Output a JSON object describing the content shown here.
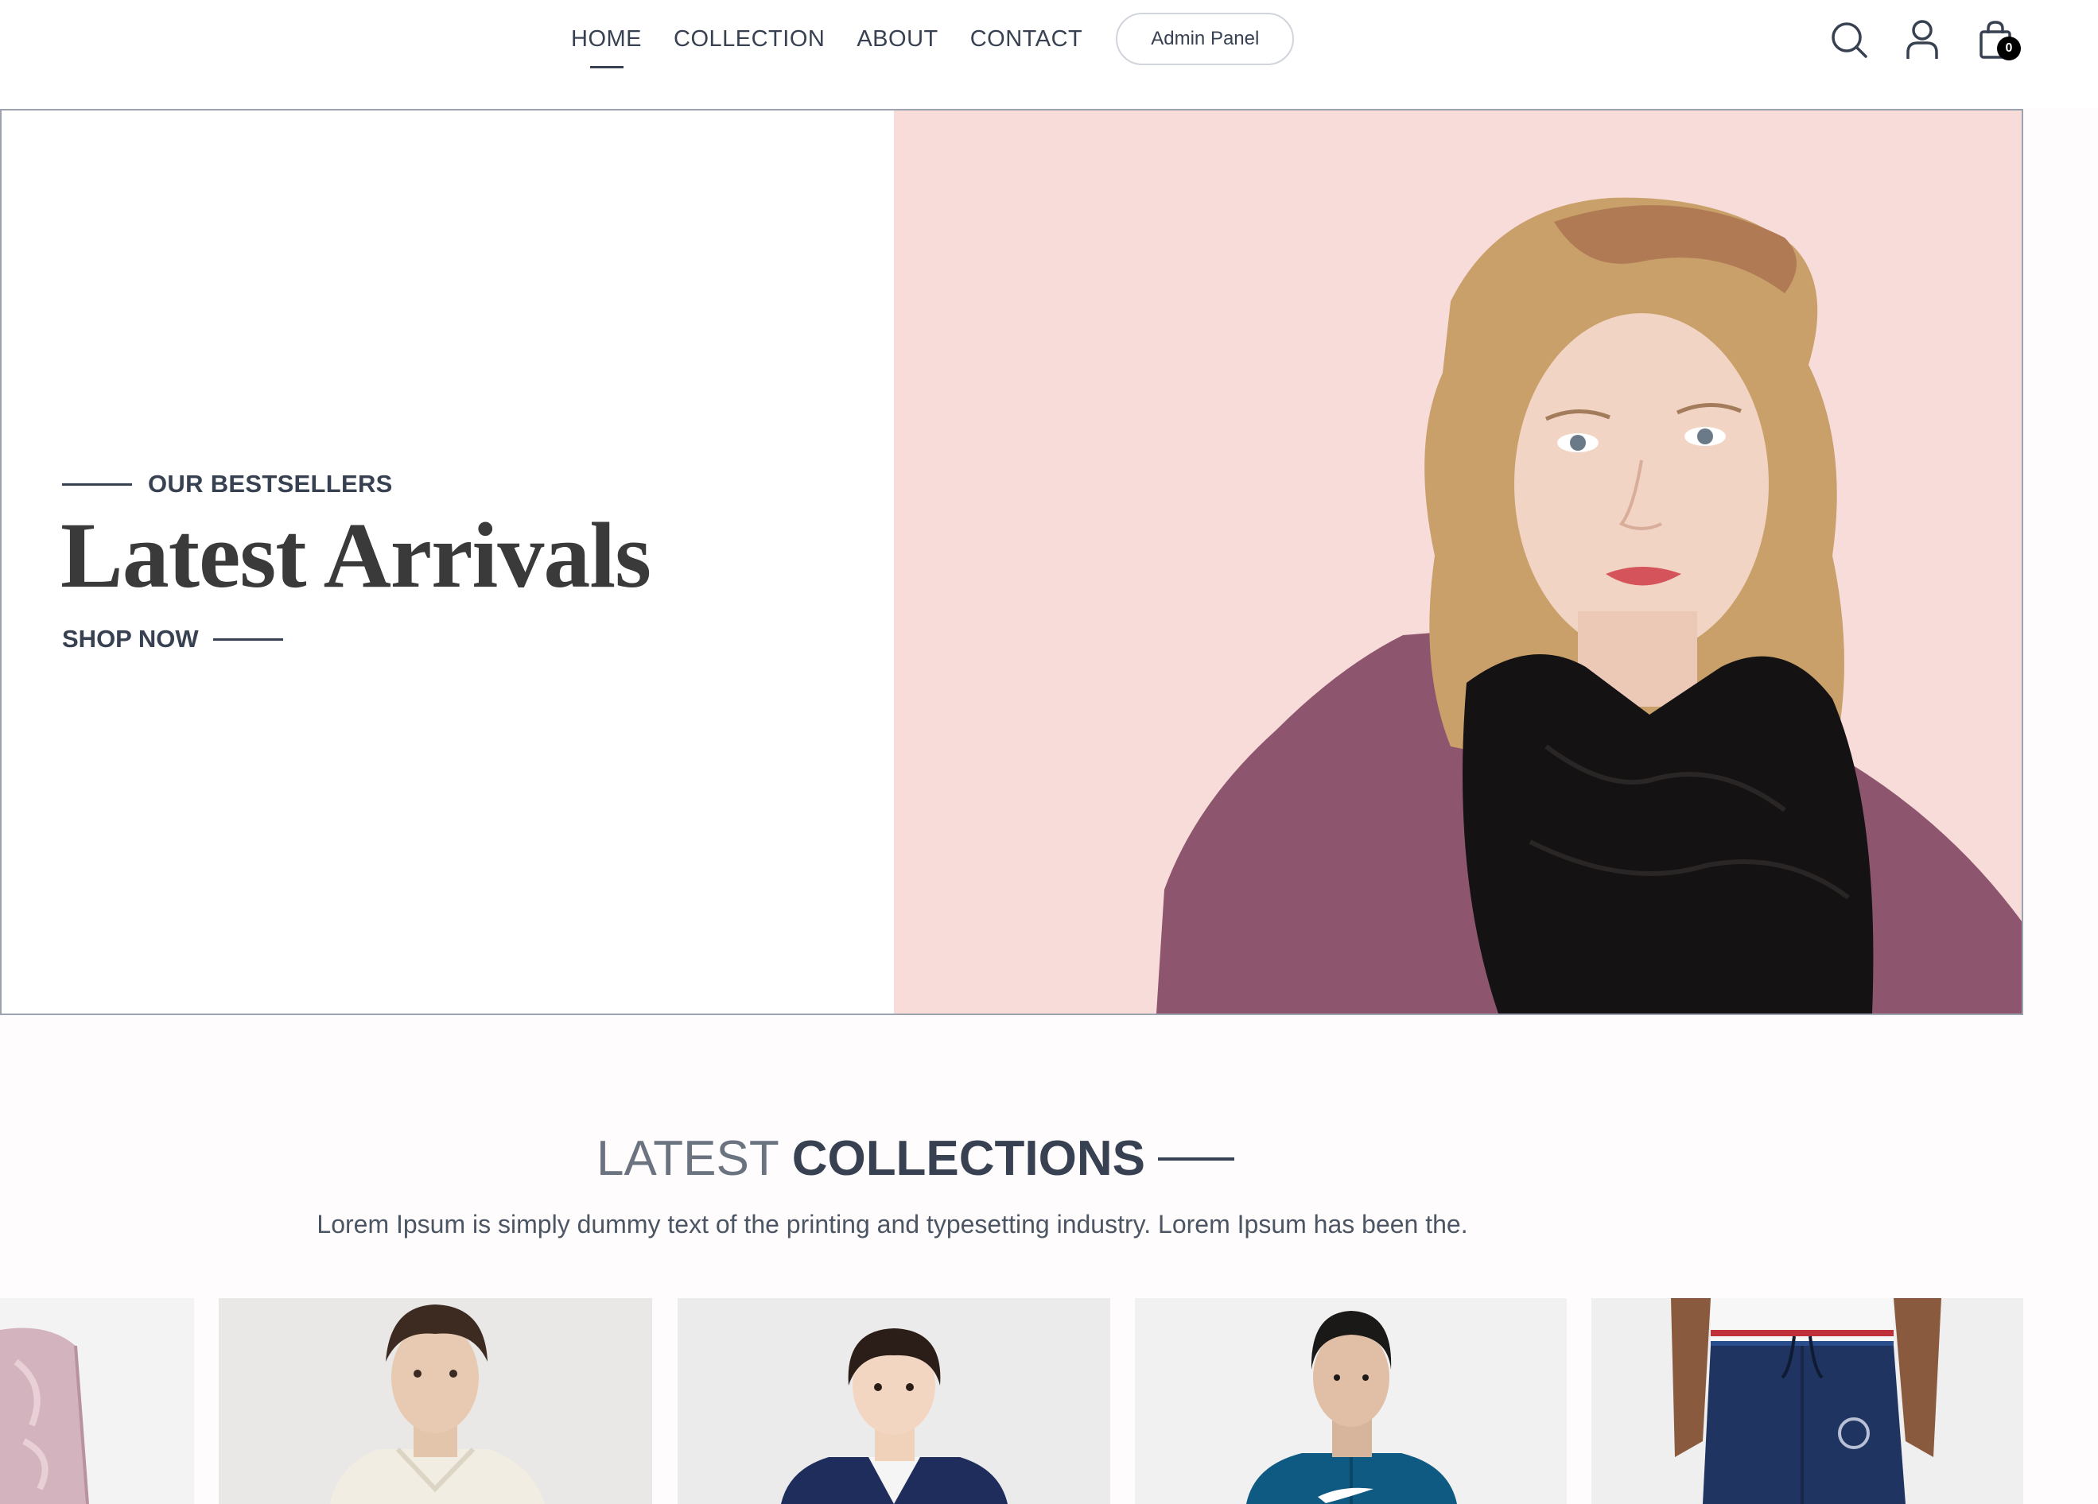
{
  "header": {
    "nav": [
      {
        "label": "HOME",
        "active": true
      },
      {
        "label": "COLLECTION",
        "active": false
      },
      {
        "label": "ABOUT",
        "active": false
      },
      {
        "label": "CONTACT",
        "active": false
      }
    ],
    "admin_label": "Admin Panel",
    "icons": [
      "search-icon",
      "user-icon",
      "shopping-bag-icon"
    ],
    "cart_count": "0"
  },
  "hero": {
    "eyebrow": "OUR BESTSELLERS",
    "title": "Latest Arrivals",
    "cta": "SHOP NOW",
    "image_background": "#f8dcda"
  },
  "collections": {
    "title_light": "LATEST",
    "title_bold": "COLLECTIONS",
    "description": "Lorem Ipsum is simply dummy text of the printing and typesetting industry. Lorem Ipsum has been the."
  },
  "products": [
    {
      "name": "pink-shorts"
    },
    {
      "name": "cream-polo-shirt"
    },
    {
      "name": "navy-kids-jacket"
    },
    {
      "name": "teal-track-jacket"
    },
    {
      "name": "navy-jogger-pants"
    }
  ]
}
